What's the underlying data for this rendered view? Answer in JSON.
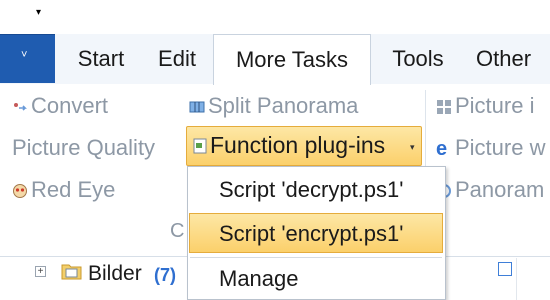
{
  "quick_access": {
    "arrow_icon": "dropdown-arrow"
  },
  "app_menu": {
    "chevron": "˅",
    "color": "#1f5cb0"
  },
  "tabs": [
    {
      "label": "Start"
    },
    {
      "label": "Edit"
    },
    {
      "label": "More Tasks",
      "active": true
    },
    {
      "label": "Tools"
    },
    {
      "label": "Other"
    }
  ],
  "ribbon": {
    "left_group": {
      "convert": "Convert",
      "picture_quality": "Picture Quality",
      "red_eye": "Red Eye"
    },
    "middle_group": {
      "split_panorama": "Split Panorama",
      "function_plugins": "Function plug-ins",
      "group_label": "C"
    },
    "right_group": {
      "picture_i": "Picture i",
      "picture_w": "Picture w",
      "panorama": "Panoram"
    }
  },
  "plugins_menu": {
    "items": [
      {
        "label": "Script 'decrypt.ps1'"
      },
      {
        "label": "Script 'encrypt.ps1'",
        "highlighted": true
      },
      {
        "label": "Manage"
      }
    ]
  },
  "tree": {
    "folder_label": "Bilder",
    "folder_count": "(7)"
  },
  "colors": {
    "accent": "#1f5cb0",
    "highlight": "#fbd06b",
    "disabled_text": "#8d98a5",
    "count": "#2f6fd0"
  }
}
